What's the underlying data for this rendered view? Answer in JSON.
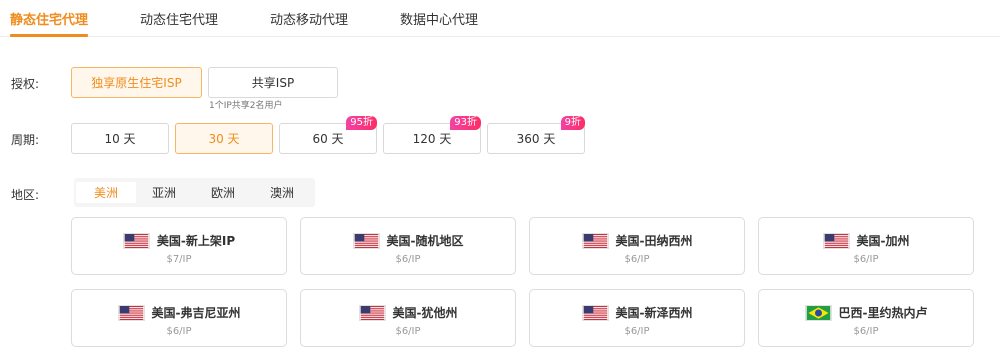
{
  "tabs": [
    {
      "label": "静态住宅代理"
    },
    {
      "label": "动态住宅代理"
    },
    {
      "label": "动态移动代理"
    },
    {
      "label": "数据中心代理"
    }
  ],
  "auth": {
    "label": "授权:",
    "options": [
      {
        "label": "独享原生住宅ISP",
        "selected": true
      },
      {
        "label": "共享ISP",
        "selected": false
      }
    ],
    "shared_note": "1个IP共享2名用户"
  },
  "period": {
    "label": "周期:",
    "options": [
      {
        "label": "10 天",
        "badge": null
      },
      {
        "label": "30 天",
        "badge": null,
        "selected": true
      },
      {
        "label": "60 天",
        "badge": "95折"
      },
      {
        "label": "120 天",
        "badge": "93折"
      },
      {
        "label": "360 天",
        "badge": "9折"
      }
    ]
  },
  "region": {
    "label": "地区:",
    "tabs": [
      {
        "label": "美洲",
        "active": true
      },
      {
        "label": "亚洲"
      },
      {
        "label": "欧洲"
      },
      {
        "label": "澳洲"
      }
    ]
  },
  "locations": [
    {
      "name": "美国-新上架IP",
      "price": "$7/IP",
      "flag": "us-flag-icon"
    },
    {
      "name": "美国-随机地区",
      "price": "$6/IP",
      "flag": "us-flag-icon"
    },
    {
      "name": "美国-田纳西州",
      "price": "$6/IP",
      "flag": "us-flag-icon"
    },
    {
      "name": "美国-加州",
      "price": "$6/IP",
      "flag": "us-flag-icon"
    },
    {
      "name": "美国-弗吉尼亚州",
      "price": "$6/IP",
      "flag": "us-flag-icon"
    },
    {
      "name": "美国-犹他州",
      "price": "$6/IP",
      "flag": "us-flag-icon"
    },
    {
      "name": "美国-新泽西州",
      "price": "$6/IP",
      "flag": "us-flag-icon"
    },
    {
      "name": "巴西-里约热内卢",
      "price": "$6/IP",
      "flag": "brazil-flag-icon"
    }
  ],
  "colors": {
    "accent": "#f08c1e",
    "badge": "#f5359a"
  }
}
